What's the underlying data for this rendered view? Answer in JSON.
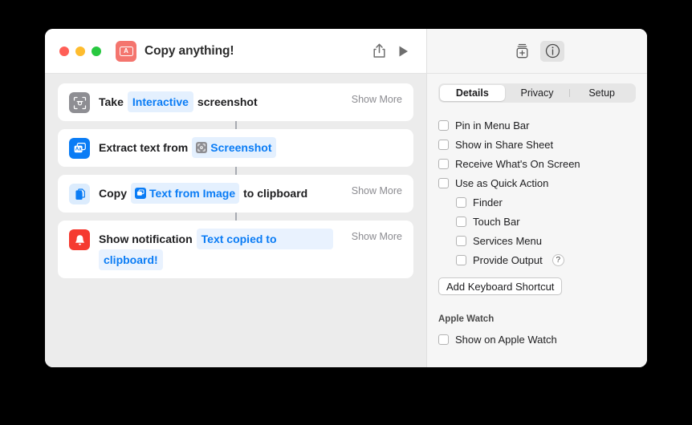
{
  "window": {
    "title": "Copy anything!",
    "app_icon": "shortcut-app-icon",
    "app_icon_letter": "A",
    "app_icon_color": "#f4756e",
    "traffic_lights": [
      "close",
      "minimize",
      "zoom"
    ],
    "share_icon": "share-icon",
    "run_icon": "play-icon"
  },
  "panel_toolbar": {
    "add_icon": "add-to-collection-icon",
    "info_icon": "info-circle-icon",
    "info_selected": true
  },
  "tabs": [
    {
      "label": "Details",
      "active": true
    },
    {
      "label": "Privacy",
      "active": false
    },
    {
      "label": "Setup",
      "active": false
    }
  ],
  "workflow": {
    "actions": [
      {
        "icon": "screenshot-camera-icon",
        "icon_color": "#8e8e93",
        "parts": [
          {
            "type": "text",
            "value": "Take"
          },
          {
            "type": "token",
            "value": "Interactive"
          },
          {
            "type": "text",
            "value": "screenshot"
          }
        ],
        "show_more": "Show More"
      },
      {
        "icon": "text-recognition-icon",
        "icon_color": "#0a7cf5",
        "parts": [
          {
            "type": "text",
            "value": "Extract text from"
          },
          {
            "type": "token_icon",
            "value": "Screenshot",
            "token_icon": "screenshot-camera-icon"
          }
        ],
        "show_more": ""
      },
      {
        "icon": "copy-documents-icon",
        "icon_color": "#dcecfd",
        "parts": [
          {
            "type": "text",
            "value": "Copy"
          },
          {
            "type": "token_icon",
            "value": "Text from Image",
            "token_icon": "text-recognition-icon"
          },
          {
            "type": "text",
            "value": "to clipboard"
          }
        ],
        "show_more": "Show More"
      },
      {
        "icon": "notification-bell-icon",
        "icon_color": "#f53a30",
        "parts": [
          {
            "type": "text",
            "value": "Show notification"
          },
          {
            "type": "field",
            "value": "Text copied to"
          },
          {
            "type": "field2",
            "value": "clipboard!"
          }
        ],
        "show_more": "Show More"
      }
    ]
  },
  "details": {
    "options": [
      {
        "label": "Pin in Menu Bar",
        "checked": false,
        "indent": false,
        "help": false
      },
      {
        "label": "Show in Share Sheet",
        "checked": false,
        "indent": false,
        "help": false
      },
      {
        "label": "Receive What's On Screen",
        "checked": false,
        "indent": false,
        "help": false
      },
      {
        "label": "Use as Quick Action",
        "checked": false,
        "indent": false,
        "help": false
      },
      {
        "label": "Finder",
        "checked": false,
        "indent": true,
        "help": false
      },
      {
        "label": "Touch Bar",
        "checked": false,
        "indent": true,
        "help": false
      },
      {
        "label": "Services Menu",
        "checked": false,
        "indent": true,
        "help": false
      },
      {
        "label": "Provide Output",
        "checked": false,
        "indent": true,
        "help": true,
        "help_label": "?"
      }
    ],
    "keyboard_shortcut_button": "Add Keyboard Shortcut",
    "apple_watch_section": "Apple Watch",
    "apple_watch_option": {
      "label": "Show on Apple Watch",
      "checked": false
    }
  }
}
